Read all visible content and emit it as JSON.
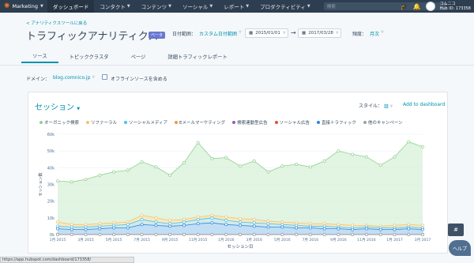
{
  "nav": {
    "brand": "Marketing",
    "items": [
      {
        "label": "ダッシュボード",
        "active": true
      },
      {
        "label": "コンタクト",
        "active": false
      },
      {
        "label": "コンテンツ",
        "active": false
      },
      {
        "label": "ソーシャル",
        "active": false
      },
      {
        "label": "レポート",
        "active": false
      },
      {
        "label": "プロダクティビティ",
        "active": false
      }
    ],
    "search_placeholder": "検索",
    "account_name": "コムニコ",
    "hub_id": "Hub ID: 173358"
  },
  "header": {
    "back_link": "< アナリティクスツールに戻る",
    "title": "トラフィックアナリティクス",
    "beta": "ベータ",
    "date_range_label": "日付範囲：",
    "date_range_value": "カスタム日付範囲",
    "date_start": "2015/01/01",
    "date_end": "2017/03/28",
    "frequency_label": "頻度：",
    "frequency_value": "月次"
  },
  "tabs": [
    {
      "label": "ソース",
      "active": true
    },
    {
      "label": "トピッククラスタ",
      "active": false
    },
    {
      "label": "ページ",
      "active": false
    },
    {
      "label": "詳細トラフィックレポート",
      "active": false
    }
  ],
  "filters": {
    "domain_label": "ドメイン：",
    "domain_value": "blog.comnico.jp",
    "offline_label": "オフラインソースを含める"
  },
  "card": {
    "metric": "セッション",
    "style_label": "スタイル：",
    "add_dashboard": "Add to dashboard"
  },
  "icons": {
    "brand": "sprocket-icon",
    "graduation": "graduation-cap-icon",
    "notifications": "bell-icon",
    "chart_style": "bar-chart-icon"
  },
  "chart_data": {
    "type": "area",
    "xlabel": "セッション日",
    "ylabel": "セッション数",
    "ylim": [
      0,
      60000
    ],
    "y_ticks": [
      "0k",
      "10k",
      "20k",
      "30k",
      "40k",
      "50k",
      "60k"
    ],
    "x_ticks": [
      "1月 2015",
      "3月 2015",
      "5月 2015",
      "7月 2015",
      "9月 2015",
      "11月 2015",
      "1月 2016",
      "3月 2016",
      "5月 2016",
      "7月 2016",
      "9月 2016",
      "11月 2016",
      "1月 2017",
      "3月 2017"
    ],
    "x_months": [
      "2015-01",
      "2015-02",
      "2015-03",
      "2015-04",
      "2015-05",
      "2015-06",
      "2015-07",
      "2015-08",
      "2015-09",
      "2015-10",
      "2015-11",
      "2015-12",
      "2016-01",
      "2016-02",
      "2016-03",
      "2016-04",
      "2016-05",
      "2016-06",
      "2016-07",
      "2016-08",
      "2016-09",
      "2016-10",
      "2016-11",
      "2016-12",
      "2017-01",
      "2017-02",
      "2017-03"
    ],
    "series": [
      {
        "name": "オーガニック検索",
        "color": "#8fd18f",
        "fill": "#d8f0d8",
        "values": [
          32000,
          31500,
          33000,
          35500,
          37500,
          38500,
          43500,
          40500,
          35500,
          43000,
          55000,
          45500,
          46000,
          41000,
          44000,
          37500,
          41000,
          42000,
          40500,
          44000,
          50000,
          48000,
          46500,
          41500,
          46500,
          55500,
          52500
        ]
      },
      {
        "name": "リファーラル",
        "color": "#f5c26b",
        "fill": "#fbe6b8",
        "values": [
          7500,
          6000,
          6000,
          6500,
          7000,
          7500,
          11500,
          10000,
          8500,
          9000,
          10500,
          11500,
          10500,
          9500,
          9000,
          8000,
          7500,
          7000,
          6500,
          6500,
          6000,
          5500,
          5500,
          5000,
          5500,
          6000,
          5500
        ]
      },
      {
        "name": "ソーシャルメディア",
        "color": "#4fc1e9",
        "fill": "#c4e9f7",
        "values": [
          5000,
          4500,
          4500,
          5000,
          5500,
          6000,
          9000,
          7500,
          6500,
          7500,
          9000,
          10000,
          8500,
          7500,
          7000,
          6500,
          6000,
          5500,
          5000,
          5000,
          4500,
          4000,
          4500,
          4000,
          4000,
          4500,
          4000
        ]
      },
      {
        "name": "Eメールマーケティング",
        "color": "#f2994a",
        "fill": "#fde3cc",
        "values": [
          200,
          200,
          200,
          200,
          200,
          200,
          200,
          200,
          200,
          200,
          200,
          200,
          200,
          200,
          200,
          200,
          200,
          200,
          200,
          200,
          200,
          200,
          200,
          200,
          200,
          200,
          200
        ]
      },
      {
        "name": "検索連動型広告",
        "color": "#9b59b6",
        "fill": "#e8d7f0",
        "values": [
          100,
          100,
          100,
          100,
          100,
          100,
          100,
          100,
          100,
          100,
          100,
          100,
          100,
          100,
          100,
          100,
          100,
          100,
          100,
          100,
          100,
          100,
          100,
          100,
          100,
          100,
          100
        ]
      },
      {
        "name": "ソーシャル広告",
        "color": "#e74c3c",
        "fill": "#f9d6d2",
        "values": [
          100,
          100,
          100,
          100,
          100,
          100,
          100,
          100,
          100,
          100,
          100,
          100,
          100,
          100,
          100,
          100,
          100,
          100,
          100,
          100,
          100,
          100,
          100,
          100,
          100,
          100,
          100
        ]
      },
      {
        "name": "直接トラフィック",
        "color": "#2e86de",
        "fill": "#bcdaf7",
        "values": [
          3500,
          3000,
          3000,
          3500,
          4000,
          4000,
          6000,
          5500,
          5000,
          5500,
          6500,
          7000,
          6000,
          5500,
          5000,
          4500,
          4500,
          4000,
          4000,
          3500,
          3500,
          3000,
          3500,
          3000,
          3000,
          3500,
          3000
        ]
      },
      {
        "name": "他のキャンペーン",
        "color": "#95a5a6",
        "fill": "#e1e6e6",
        "values": [
          0,
          0,
          0,
          0,
          0,
          0,
          0,
          0,
          0,
          0,
          0,
          0,
          0,
          0,
          0,
          0,
          0,
          0,
          0,
          0,
          0,
          0,
          0,
          0,
          0,
          0,
          0
        ]
      }
    ]
  },
  "help": {
    "label": "ヘルプ",
    "hash": "#"
  },
  "status_url": "https://app.hubspot.com/dashboard/173358/"
}
